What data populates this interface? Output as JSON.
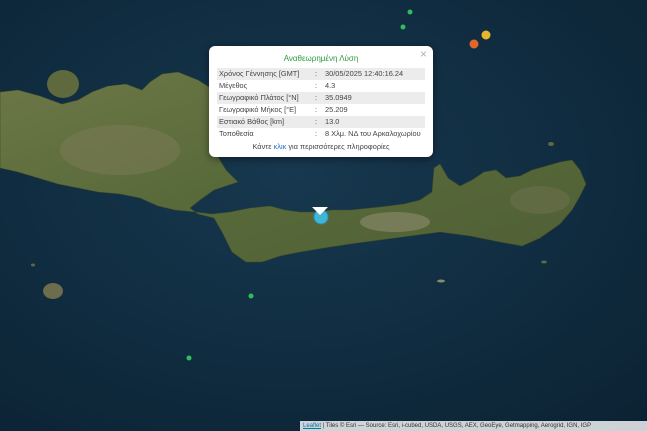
{
  "popup": {
    "title": "Αναθεωρημένη Λύση",
    "close_label": "×",
    "rows": [
      {
        "key": "Χρόνος Γέννησης [GMT]",
        "sep": ":",
        "value": "30/05/2025 12:40:16.24"
      },
      {
        "key": "Μέγεθος",
        "sep": ":",
        "value": "4.3"
      },
      {
        "key": "Γεωγραφικό Πλάτος [°N]",
        "sep": ":",
        "value": "35.0949"
      },
      {
        "key": "Γεωγραφικό Μήκος [°E]",
        "sep": ":",
        "value": "25.209"
      },
      {
        "key": "Εστιακό Βάθος [km]",
        "sep": ":",
        "value": "13.0"
      },
      {
        "key": "Τοποθεσία",
        "sep": ":",
        "value": "8 Χλμ. ΝΔ του Αρκαλοχωρίου"
      }
    ],
    "more_prefix": "Κάντε ",
    "more_link": "κλικ",
    "more_suffix": " για περισσότερες πληροφορίες"
  },
  "attribution": {
    "leaflet": "Leaflet",
    "text": " | Tiles © Esri — Source: Esri, i-cubed, USDA, USGS, AEX, GeoEye, Getmapping, Aerogrid, IGN, IGP"
  },
  "colors": {
    "sea": "#12324a",
    "land": "#5e6e3e",
    "selected_marker": "#3fb6d6",
    "small_quake": "#2fbf5a",
    "orange_quake": "#e2662a",
    "yellow_quake": "#e8b62c"
  },
  "markers": [
    {
      "name": "quake-marker-selected",
      "color": "selected_marker"
    },
    {
      "name": "quake-marker-green",
      "color": "small_quake"
    },
    {
      "name": "quake-marker-green",
      "color": "small_quake"
    },
    {
      "name": "quake-marker-green",
      "color": "small_quake"
    },
    {
      "name": "quake-marker-green",
      "color": "small_quake"
    },
    {
      "name": "quake-marker-orange",
      "color": "orange_quake"
    },
    {
      "name": "quake-marker-yellow",
      "color": "yellow_quake"
    }
  ]
}
